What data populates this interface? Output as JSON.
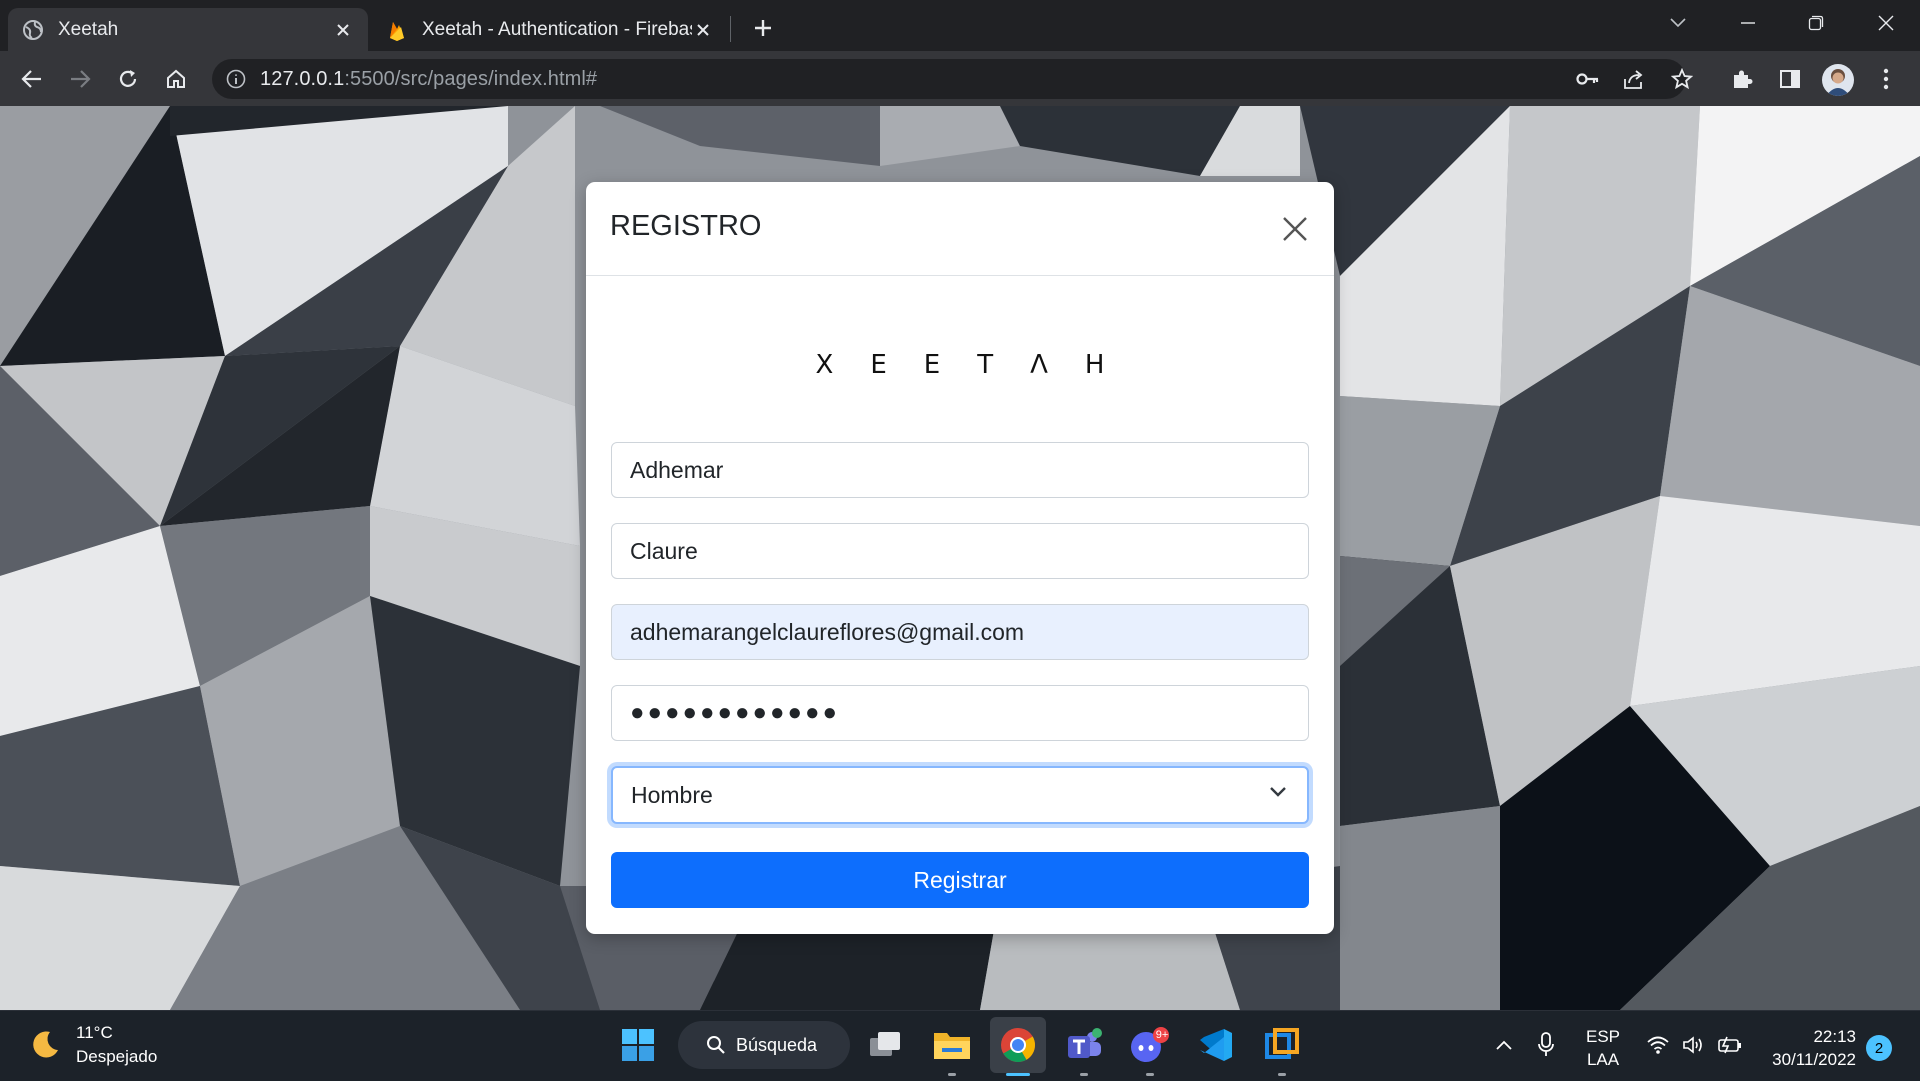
{
  "browser": {
    "tabs": [
      {
        "title": "Xeetah",
        "active": true
      },
      {
        "title": "Xeetah - Authentication - Firebas",
        "active": false
      }
    ],
    "url_host": "127.0.0.1",
    "url_rest": ":5500/src/pages/index.html#"
  },
  "modal": {
    "title": "REGISTRO",
    "logo_text": "XEETΛH",
    "fields": {
      "first_name": "Adhemar",
      "last_name": "Claure",
      "email": "adhemarangelclaureflores@gmail.com",
      "password_mask": "●●●●●●●●●●●●",
      "gender_selected": "Hombre"
    },
    "submit_label": "Registrar"
  },
  "taskbar": {
    "weather_temp": "11°C",
    "weather_desc": "Despejado",
    "search_label": "Búsqueda",
    "discord_badge": "9+",
    "lang_top": "ESP",
    "lang_bottom": "LAA",
    "time": "22:13",
    "date": "30/11/2022",
    "notification_count": "2"
  },
  "colors": {
    "primary_button": "#0d6efd",
    "chrome_dark": "#202124",
    "chrome_toolbar": "#35363a",
    "taskbar": "#1c2229"
  }
}
